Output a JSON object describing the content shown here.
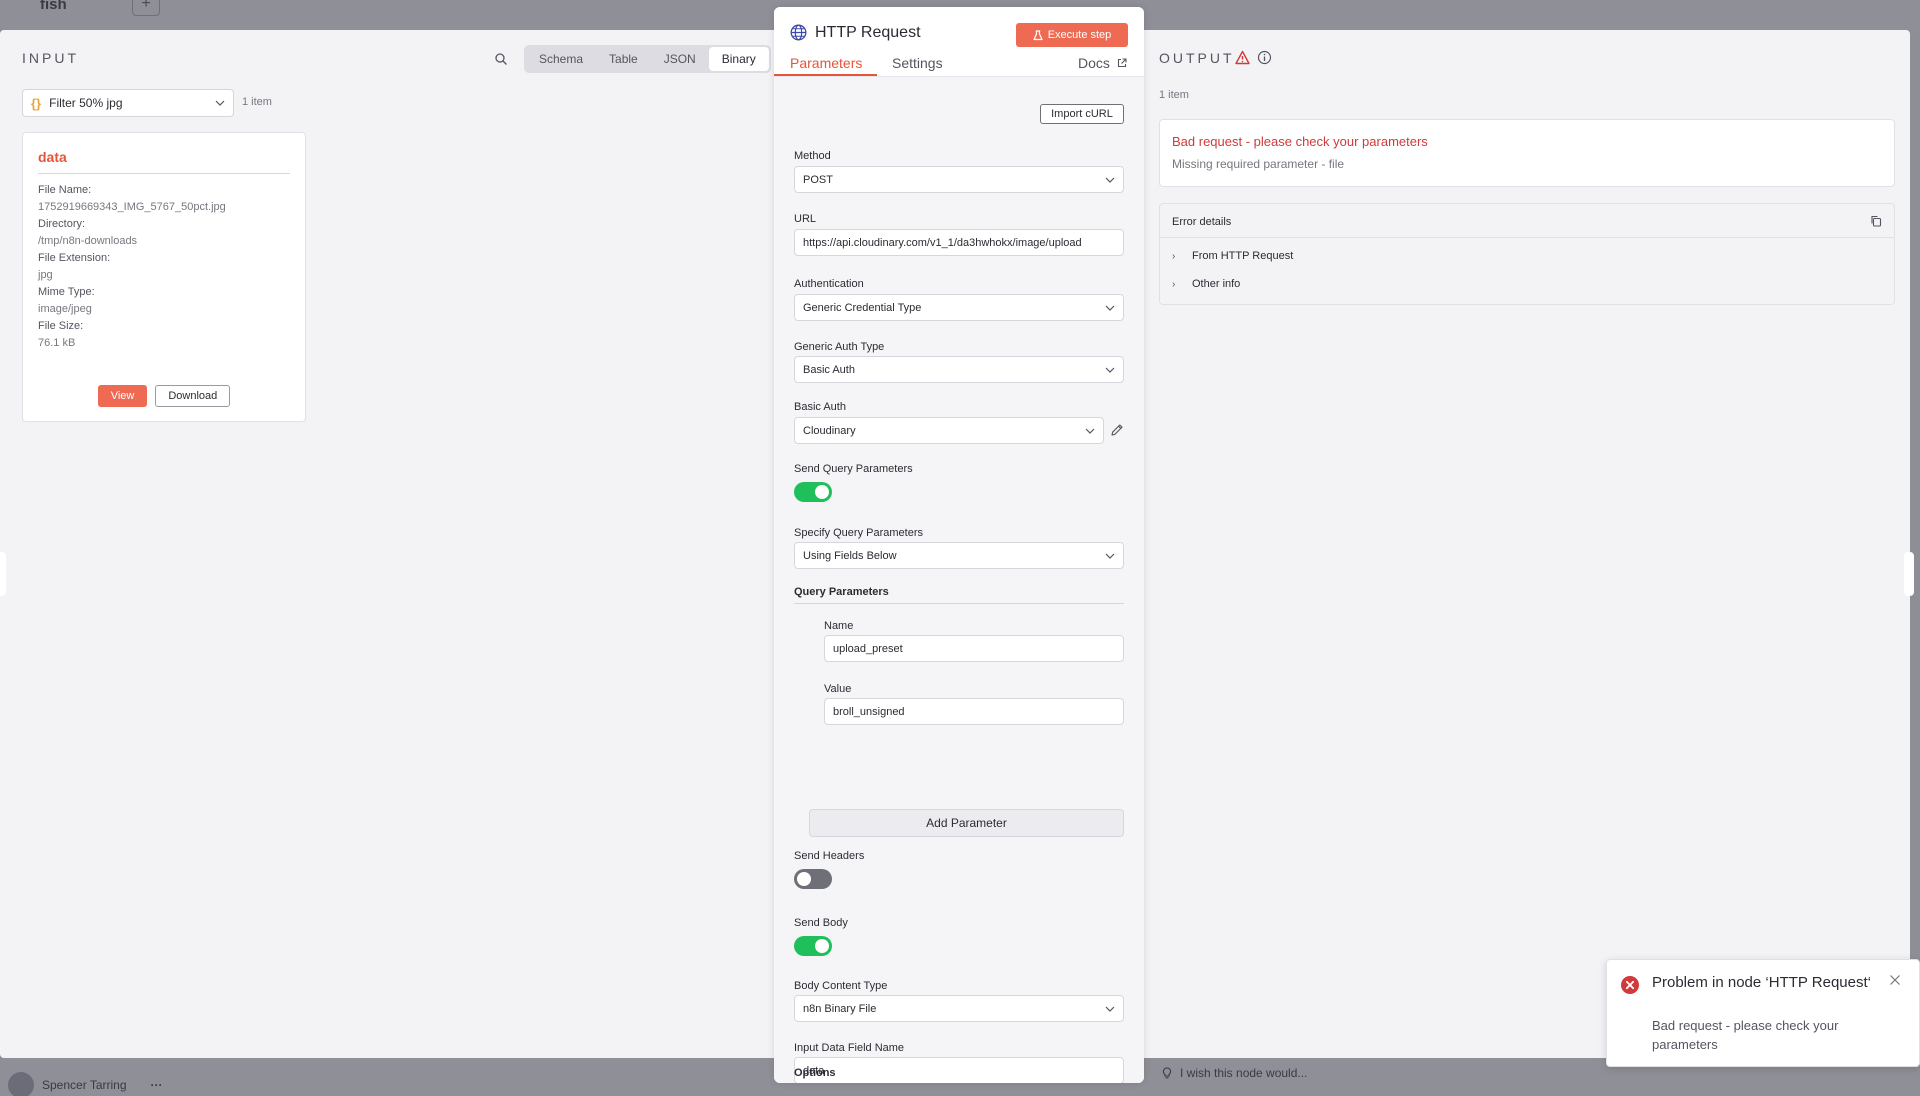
{
  "background": {
    "title": "fish",
    "plus": "+",
    "user_name": "Spencer Tarring",
    "user_menu": "···"
  },
  "input": {
    "title": "INPUT",
    "view_tabs": [
      "Schema",
      "Table",
      "JSON",
      "Binary"
    ],
    "active_view": "Binary",
    "node_select": "Filter 50% jpg",
    "items_count": "1 item",
    "card": {
      "title": "data",
      "fields": [
        {
          "key": "File Name:",
          "value": "1752919669343_IMG_5767_50pct.jpg"
        },
        {
          "key": "Directory:",
          "value": "/tmp/n8n-downloads"
        },
        {
          "key": "File Extension:",
          "value": "jpg"
        },
        {
          "key": "Mime Type:",
          "value": "image/jpeg"
        },
        {
          "key": "File Size:",
          "value": "76.1 kB"
        }
      ],
      "view_label": "View",
      "download_label": "Download"
    }
  },
  "node": {
    "title": "HTTP Request",
    "execute_label": "Execute step",
    "tabs": {
      "parameters": "Parameters",
      "settings": "Settings",
      "docs": "Docs"
    },
    "import_curl": "Import cURL",
    "method_label": "Method",
    "method_value": "POST",
    "url_label": "URL",
    "url_value": "https://api.cloudinary.com/v1_1/da3hwhokx/image/upload",
    "auth_label": "Authentication",
    "auth_value": "Generic Credential Type",
    "generic_auth_label": "Generic Auth Type",
    "generic_auth_value": "Basic Auth",
    "basic_auth_label": "Basic Auth",
    "basic_auth_value": "Cloudinary",
    "send_query_label": "Send Query Parameters",
    "send_query_on": true,
    "specify_query_label": "Specify Query Parameters",
    "specify_query_value": "Using Fields Below",
    "query_params_title": "Query Parameters",
    "param_name_label": "Name",
    "param_name_value": "upload_preset",
    "param_value_label": "Value",
    "param_value_value": "broll_unsigned",
    "add_param_label": "Add Parameter",
    "send_headers_label": "Send Headers",
    "send_headers_on": false,
    "send_body_label": "Send Body",
    "send_body_on": true,
    "body_content_label": "Body Content Type",
    "body_content_value": "n8n Binary File",
    "input_field_label": "Input Data Field Name",
    "input_field_value": "data",
    "options_title": "Options"
  },
  "output": {
    "title": "OUTPUT",
    "items_count": "1 item",
    "error_title": "Bad request - please check your parameters",
    "error_sub": "Missing required parameter - file",
    "details_title": "Error details",
    "detail_rows": [
      "From HTTP Request",
      "Other info"
    ]
  },
  "footer": {
    "hint": "I wish this node would..."
  },
  "toast": {
    "title": "Problem in node ‘HTTP Request‘",
    "message": "Bad request - please check your parameters"
  },
  "colors": {
    "accent": "#ee6a52",
    "error": "#d03a3a",
    "toggle_on": "#1fbf5b",
    "toggle_off": "#6f6f78"
  }
}
